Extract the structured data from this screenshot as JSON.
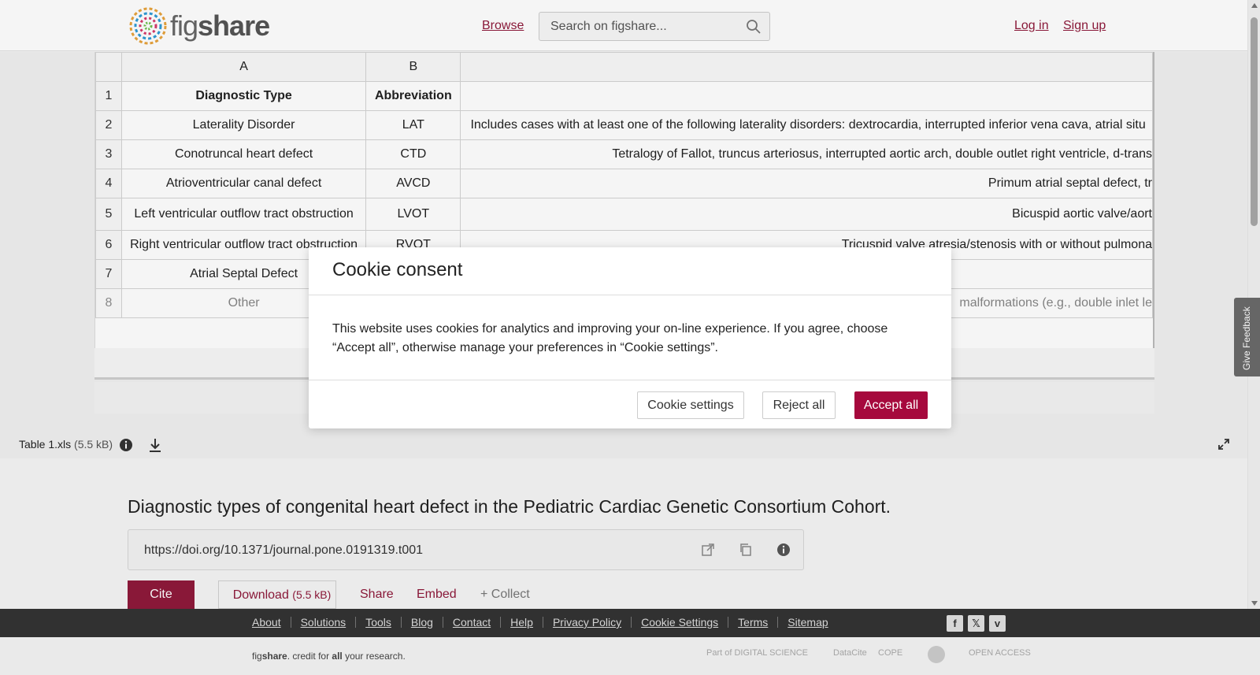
{
  "header": {
    "logo_text_light": "fig",
    "logo_text_bold": "share",
    "browse": "Browse",
    "search_placeholder": "Search on figshare...",
    "login": "Log in",
    "signup": "Sign up"
  },
  "sheet": {
    "col_headers": [
      "A",
      "B"
    ],
    "rows": [
      {
        "n": "1",
        "a": "Diagnostic Type",
        "b": "Abbreviation",
        "c": ""
      },
      {
        "n": "2",
        "a": "Laterality Disorder",
        "b": "LAT",
        "c": "Includes cases with at least one of the following laterality disorders: dextrocardia, interrupted inferior vena cava, atrial situ"
      },
      {
        "n": "3",
        "a": "Conotruncal heart defect",
        "b": "CTD",
        "c": "Tetralogy of Fallot, truncus arteriosus, interrupted aortic arch, double outlet right ventricle, d-trans"
      },
      {
        "n": "4",
        "a": "Atrioventricular canal defect",
        "b": "AVCD",
        "c": "Primum atrial septal defect, tr"
      },
      {
        "n": "5",
        "a": "Left ventricular outflow tract obstruction",
        "b": "LVOT",
        "c": "Bicuspid aortic valve/aort"
      },
      {
        "n": "6",
        "a": "Right ventricular outflow tract obstruction",
        "b": "RVOT",
        "c": "Tricuspid valve atresia/stenosis with or without pulmona"
      },
      {
        "n": "7",
        "a": "Atrial Septal Defect",
        "b": "",
        "c": ""
      },
      {
        "n": "8",
        "a": "Other",
        "b": "",
        "c": "malformations (e.g., double inlet le"
      }
    ]
  },
  "file": {
    "name": "Table 1.xls",
    "size": "(5.5 kB)"
  },
  "feedback": "Give Feedback",
  "article": {
    "title": "Diagnostic types of congenital heart defect in the Pediatric Cardiac Genetic Consortium Cohort.",
    "doi": "https://doi.org/10.1371/journal.pone.0191319.t001",
    "cite": "Cite",
    "download": "Download",
    "download_size": "(5.5 kB)",
    "share": "Share",
    "embed": "Embed",
    "collect": "+ Collect"
  },
  "footer": {
    "links": [
      "About",
      "Solutions",
      "Tools",
      "Blog",
      "Contact",
      "Help",
      "Privacy Policy",
      "Cookie Settings",
      "Terms",
      "Sitemap"
    ],
    "tagline_fig": "fig",
    "tagline_share": "share",
    "tagline_mid": ". credit for ",
    "tagline_all": "all",
    "tagline_end": " your research.",
    "partner_ds": "Part of DIGITAL SCIENCE",
    "partner_datacite": "DataCite",
    "partner_cope": "COPE",
    "partner_oa": "OPEN ACCESS"
  },
  "cookie": {
    "title": "Cookie consent",
    "body": "This website uses cookies for analytics and improving your on-line experience. If you agree, choose “Accept all”, otherwise manage your preferences in “Cookie settings”.",
    "settings": "Cookie settings",
    "reject": "Reject all",
    "accept": "Accept all"
  },
  "colors": {
    "brand": "#8f1a3b",
    "accept": "#a6093d",
    "footer_bg": "#333333"
  }
}
